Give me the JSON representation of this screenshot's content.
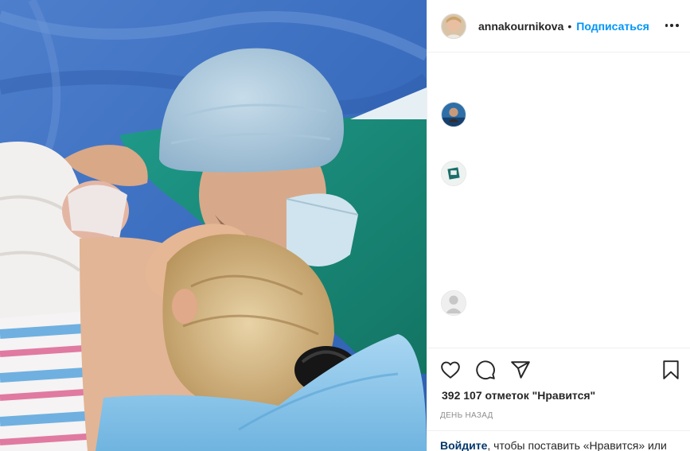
{
  "post": {
    "photo_label": "photo-post-image"
  },
  "header": {
    "username": "annakournikova",
    "separator": "•",
    "follow_label": "Подписаться"
  },
  "actions": {
    "likes_text": "392 107 отметок \"Нравится\"",
    "time_text": "ДЕНЬ НАЗАД"
  },
  "login": {
    "link_label": "Войдите",
    "rest_text": ", чтобы поставить «Нравится» или"
  },
  "colors": {
    "accent": "#0095f6",
    "text": "#262626",
    "muted": "#8e8e8e",
    "border": "#efefef"
  }
}
